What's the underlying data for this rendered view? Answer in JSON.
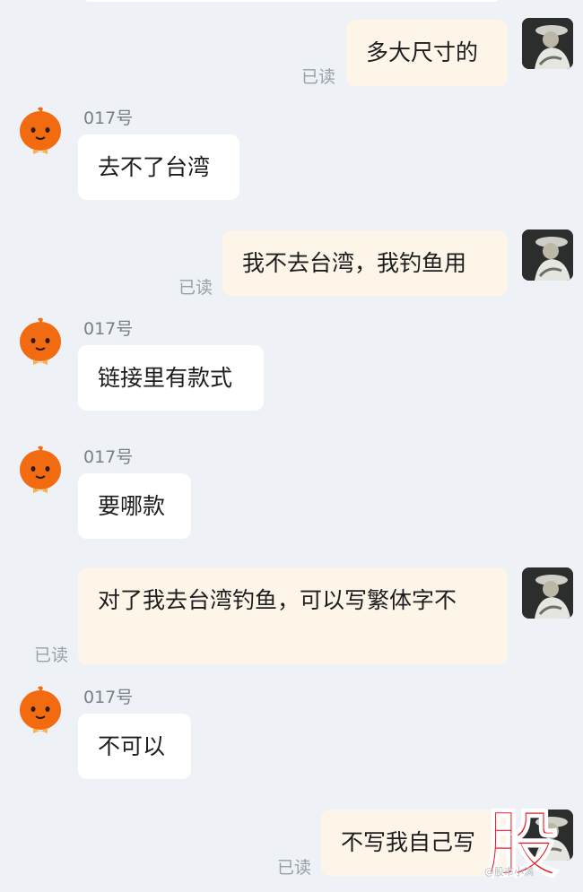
{
  "read_label": "已读",
  "sender_name": "017号",
  "messages": [
    {
      "side": "out",
      "text": "多大尺寸的"
    },
    {
      "side": "in",
      "text": "去不了台湾"
    },
    {
      "side": "out",
      "text": "我不去台湾，我钓鱼用"
    },
    {
      "side": "in",
      "text": "链接里有款式"
    },
    {
      "side": "in",
      "text": "要哪款"
    },
    {
      "side": "out",
      "text": "对了我去台湾钓鱼，可以写繁体字不"
    },
    {
      "side": "in",
      "text": "不可以"
    },
    {
      "side": "out",
      "text": "不写我自己写"
    }
  ],
  "watermark": {
    "logo_char": "股",
    "caption": "@股市小满"
  },
  "colors": {
    "bot_avatar": "#f36b10",
    "outgoing_bubble": "#fdf6e8",
    "incoming_bubble": "#ffffff",
    "watermark": "#e8141b"
  },
  "icons": {
    "bot_avatar": "orange-mascot-icon",
    "user_avatar": "user-photo-avatar"
  }
}
